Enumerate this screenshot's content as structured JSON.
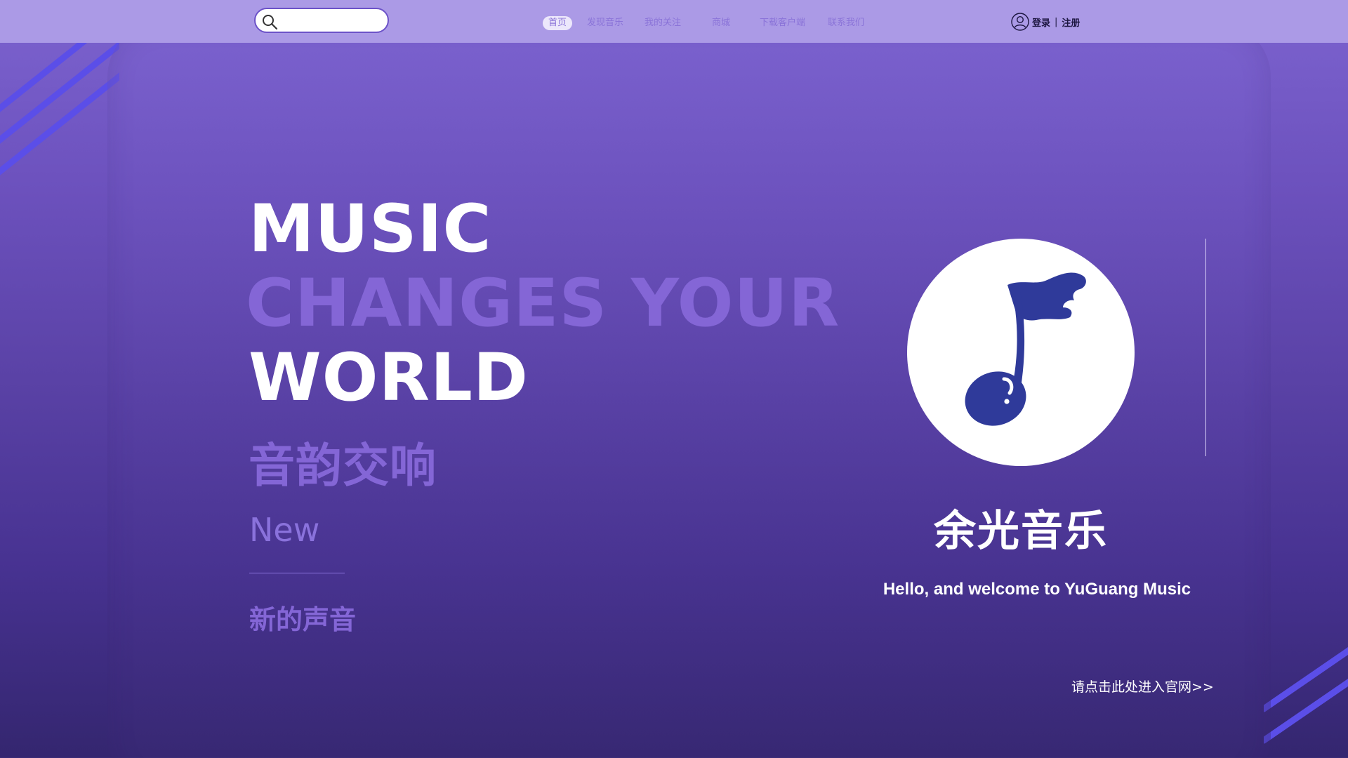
{
  "search": {
    "value": "",
    "placeholder": ""
  },
  "nav": {
    "items": [
      {
        "label": "首页",
        "active": true
      },
      {
        "label": "发现音乐"
      },
      {
        "label": "我的关注"
      },
      {
        "label": "商城"
      },
      {
        "label": "下载客户端"
      },
      {
        "label": "联系我们"
      }
    ]
  },
  "account": {
    "login": "登录",
    "separator": "|",
    "register": "注册"
  },
  "hero": {
    "line1": "MUSIC",
    "line2": "CHANGES YOUR",
    "line3": "WORLD",
    "cn_title": "音韵交响",
    "new_label": "New",
    "sub_label": "新的声音"
  },
  "brand": {
    "name": "余光音乐",
    "welcome": "Hello, and welcome to YuGuang Music",
    "enter_link": "请点击此处进入官网>>"
  },
  "colors": {
    "bg_top": "#7c63cf",
    "bg_bottom": "#34266f",
    "topbar": "#ab9ae6",
    "accent": "#8466d6",
    "logo_note": "#2f3a9a",
    "stripe": "#5b4ee8"
  },
  "icons": {
    "search": "search-icon",
    "user": "user-icon",
    "logo": "music-note-icon"
  }
}
